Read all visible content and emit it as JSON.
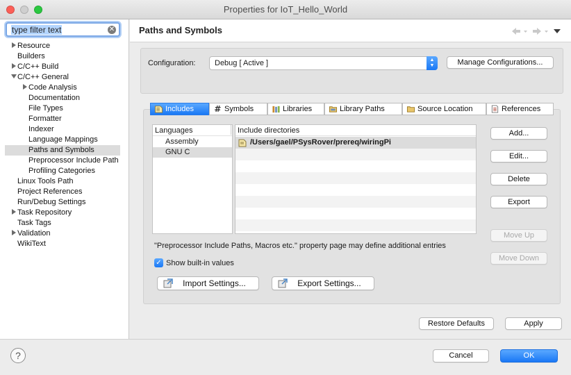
{
  "window": {
    "title": "Properties for IoT_Hello_World"
  },
  "filter": {
    "placeholder": "type filter text",
    "value": "type filter text"
  },
  "tree": [
    {
      "label": "Resource",
      "twisty": "collapsed"
    },
    {
      "label": "Builders",
      "twisty": "none"
    },
    {
      "label": "C/C++ Build",
      "twisty": "collapsed"
    },
    {
      "label": "C/C++ General",
      "twisty": "expanded"
    },
    {
      "label": "Code Analysis",
      "twisty": "collapsed"
    },
    {
      "label": "Documentation",
      "twisty": "none"
    },
    {
      "label": "File Types",
      "twisty": "none"
    },
    {
      "label": "Formatter",
      "twisty": "none"
    },
    {
      "label": "Indexer",
      "twisty": "none"
    },
    {
      "label": "Language Mappings",
      "twisty": "none"
    },
    {
      "label": "Paths and Symbols",
      "twisty": "none",
      "selected": true
    },
    {
      "label": "Preprocessor Include Path",
      "twisty": "none"
    },
    {
      "label": "Profiling Categories",
      "twisty": "none"
    },
    {
      "label": "Linux Tools Path",
      "twisty": "none"
    },
    {
      "label": "Project References",
      "twisty": "none"
    },
    {
      "label": "Run/Debug Settings",
      "twisty": "none"
    },
    {
      "label": "Task Repository",
      "twisty": "collapsed"
    },
    {
      "label": "Task Tags",
      "twisty": "none"
    },
    {
      "label": "Validation",
      "twisty": "collapsed"
    },
    {
      "label": "WikiText",
      "twisty": "none"
    }
  ],
  "page": {
    "title": "Paths and Symbols"
  },
  "config": {
    "label": "Configuration:",
    "value": "Debug  [ Active ]",
    "manage_label": "Manage Configurations..."
  },
  "tabs": [
    {
      "label": "Includes",
      "icon": "includes-icon",
      "active": true
    },
    {
      "label": "Symbols",
      "icon": "hash-icon",
      "active": false
    },
    {
      "label": "Libraries",
      "icon": "libraries-icon",
      "active": false
    },
    {
      "label": "Library Paths",
      "icon": "folder-icon",
      "active": false
    },
    {
      "label": "Source Location",
      "icon": "source-folder-icon",
      "active": false
    },
    {
      "label": "References",
      "icon": "references-icon",
      "active": false
    }
  ],
  "languages": {
    "header": "Languages",
    "items": [
      {
        "label": "Assembly"
      },
      {
        "label": "GNU C",
        "selected": true
      }
    ]
  },
  "includes": {
    "header": "Include directories",
    "items": [
      {
        "label": "/Users/gael/PSysRover/prereq/wiringPi"
      }
    ]
  },
  "side_buttons": {
    "add": "Add...",
    "edit": "Edit...",
    "delete": "Delete",
    "export": "Export",
    "move_up": "Move Up",
    "move_down": "Move Down"
  },
  "note": "\"Preprocessor Include Paths, Macros etc.\" property page may define additional entries",
  "show_builtin": {
    "label": "Show built-in values",
    "checked": true
  },
  "import_label": "Import Settings...",
  "export_label": "Export Settings...",
  "restore_label": "Restore Defaults",
  "apply_label": "Apply",
  "cancel_label": "Cancel",
  "ok_label": "OK",
  "help_label": "?",
  "colors": {
    "accent": "#1a78f5",
    "traffic_close": "#fc5f57",
    "traffic_min": "#cfcfcf",
    "traffic_max": "#2bc840"
  }
}
